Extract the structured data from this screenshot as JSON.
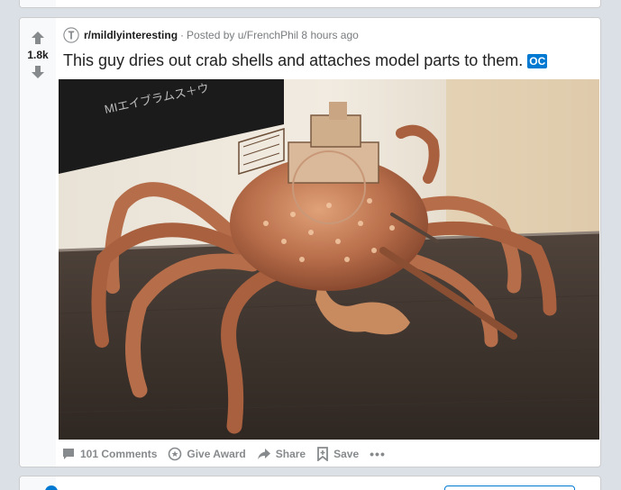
{
  "post": {
    "subreddit": "r/mildlyinteresting",
    "separator": "·",
    "posted_by": "Posted by u/FrenchPhil 8 hours ago",
    "title": "This guy dries out crab shells and attaches model parts to them.",
    "flair": "OC",
    "vote_count": "1.8k",
    "image_sign_text": "MIエイブラムス＋ウ"
  },
  "actions": {
    "comments": "101 Comments",
    "award": "Give Award",
    "share": "Share",
    "save": "Save",
    "more": "•••"
  },
  "colors": {
    "page_bg": "#dae0e6",
    "card_bg": "#ffffff",
    "accent": "#0079d3",
    "muted": "#878a8c"
  },
  "icons": [
    "upvote-icon",
    "downvote-icon",
    "subreddit-icon",
    "comment-icon",
    "award-icon",
    "share-icon",
    "save-icon"
  ]
}
